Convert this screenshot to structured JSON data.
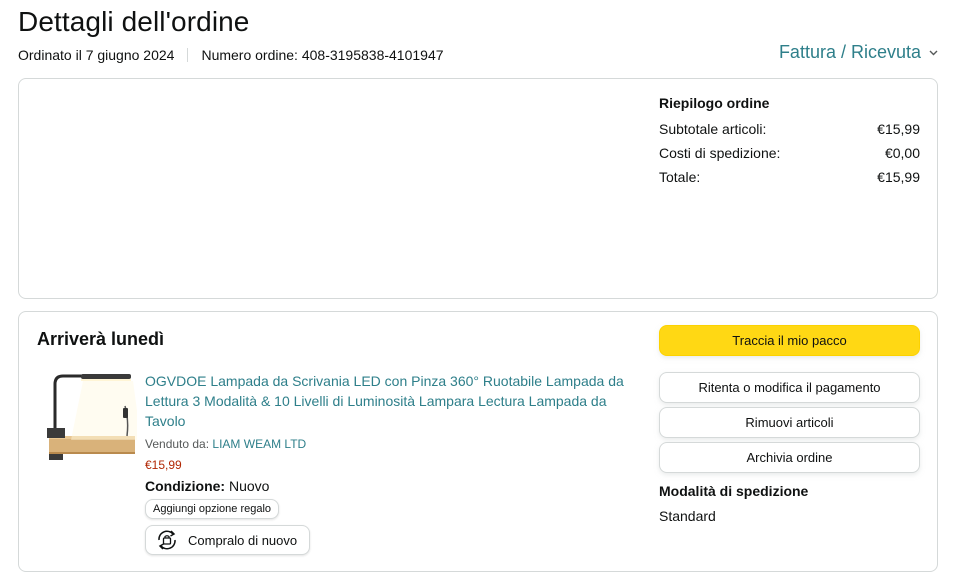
{
  "header": {
    "title": "Dettagli dell'ordine",
    "order_date": "Ordinato il 7 giugno 2024",
    "order_number": "Numero ordine: 408-3195838-4101947",
    "invoice_label": "Fattura / Ricevuta"
  },
  "summary": {
    "heading": "Riepilogo ordine",
    "rows": [
      {
        "label": "Subtotale articoli:",
        "value": "€15,99"
      },
      {
        "label": "Costi di spedizione:",
        "value": "€0,00"
      },
      {
        "label": "Totale:",
        "value": "€15,99"
      }
    ]
  },
  "shipment": {
    "title": "Arriverà lunedì",
    "product": {
      "title": "OGVDOE Lampada da Scrivania LED con Pinza 360° Ruotabile Lampada da Lettura 3 Modalità & 10 Livelli di Luminosità Lampara Lectura Lampada da Tavolo",
      "sold_by_prefix": "Venduto da: ",
      "seller": "LIAM WEAM LTD",
      "price": "€15,99",
      "condition_label": "Condizione:",
      "condition_value": "Nuovo",
      "gift_label": "Aggiungi opzione regalo",
      "rebuy_label": "Compralo di nuovo",
      "image_icon": "desk-lamp-product-image"
    },
    "actions": {
      "track": "Traccia il mio pacco",
      "retry_payment": "Ritenta o modifica il pagamento",
      "remove_items": "Rimuovi articoli",
      "archive": "Archivia ordine"
    },
    "shipping_mode_label": "Modalità di spedizione",
    "shipping_mode_value": "Standard"
  },
  "colors": {
    "link": "#2e7f8a",
    "price": "#b12704",
    "primary_button": "#ffd814",
    "border": "#d5d9d9"
  }
}
